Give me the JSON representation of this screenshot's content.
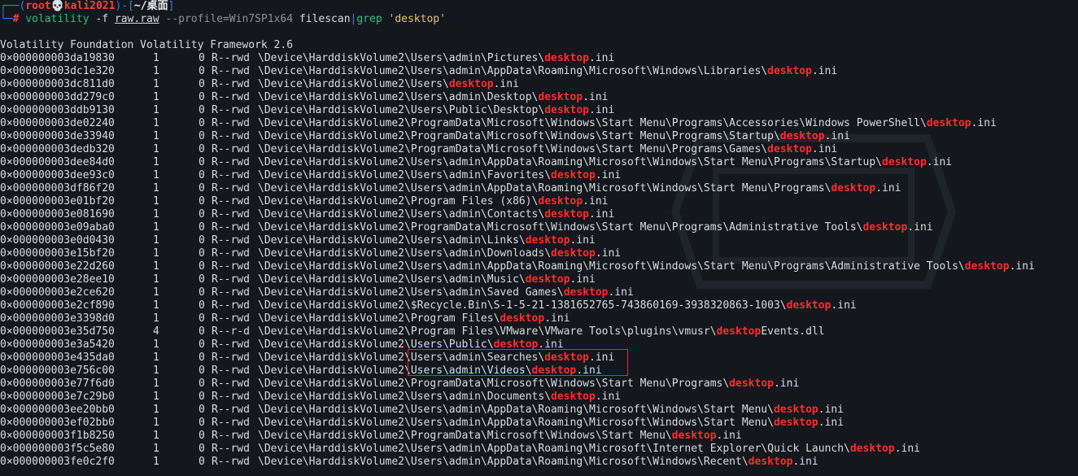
{
  "prompt": {
    "user": "root",
    "skull": "💀",
    "host": "kali2021",
    "cwd": "~/桌面",
    "hash": "#"
  },
  "command": {
    "program": "volatility",
    "flag_f": "-f",
    "image": "raw.raw",
    "profile": "--profile=Win7SP1x64",
    "plugin": "filescan",
    "pipe": "|",
    "grep": "grep",
    "pattern": "'desktop'"
  },
  "banner": "Volatility Foundation Volatility Framework 2.6",
  "search_term": "desktop",
  "rows": [
    {
      "offset": "0×000000003da19830",
      "p": "1",
      "h": "0",
      "acc": "R--rwd",
      "pre": "\\Device\\HarddiskVolume2\\Users\\admin\\Pictures\\",
      "hit": "desktop",
      "post": ".ini"
    },
    {
      "offset": "0×000000003dc1e320",
      "p": "1",
      "h": "0",
      "acc": "R--rwd",
      "pre": "\\Device\\HarddiskVolume2\\Users\\admin\\AppData\\Roaming\\Microsoft\\Windows\\Libraries\\",
      "hit": "desktop",
      "post": ".ini"
    },
    {
      "offset": "0×000000003dc811d0",
      "p": "1",
      "h": "0",
      "acc": "R--rwd",
      "pre": "\\Device\\HarddiskVolume2\\Users\\",
      "hit": "desktop",
      "post": ".ini"
    },
    {
      "offset": "0×000000003dd279c0",
      "p": "1",
      "h": "0",
      "acc": "R--rwd",
      "pre": "\\Device\\HarddiskVolume2\\Users\\admin\\Desktop\\",
      "hit": "desktop",
      "post": ".ini"
    },
    {
      "offset": "0×000000003ddb9130",
      "p": "1",
      "h": "0",
      "acc": "R--rwd",
      "pre": "\\Device\\HarddiskVolume2\\Users\\Public\\Desktop\\",
      "hit": "desktop",
      "post": ".ini"
    },
    {
      "offset": "0×000000003de02240",
      "p": "1",
      "h": "0",
      "acc": "R--rwd",
      "pre": "\\Device\\HarddiskVolume2\\ProgramData\\Microsoft\\Windows\\Start Menu\\Programs\\Accessories\\Windows PowerShell\\",
      "hit": "desktop",
      "post": ".ini"
    },
    {
      "offset": "0×000000003de33940",
      "p": "1",
      "h": "0",
      "acc": "R--rwd",
      "pre": "\\Device\\HarddiskVolume2\\ProgramData\\Microsoft\\Windows\\Start Menu\\Programs\\Startup\\",
      "hit": "desktop",
      "post": ".ini"
    },
    {
      "offset": "0×000000003dedb320",
      "p": "1",
      "h": "0",
      "acc": "R--rwd",
      "pre": "\\Device\\HarddiskVolume2\\ProgramData\\Microsoft\\Windows\\Start Menu\\Programs\\Games\\",
      "hit": "desktop",
      "post": ".ini"
    },
    {
      "offset": "0×000000003dee84d0",
      "p": "1",
      "h": "0",
      "acc": "R--rwd",
      "pre": "\\Device\\HarddiskVolume2\\Users\\admin\\AppData\\Roaming\\Microsoft\\Windows\\Start Menu\\Programs\\Startup\\",
      "hit": "desktop",
      "post": ".ini"
    },
    {
      "offset": "0×000000003dee93c0",
      "p": "1",
      "h": "0",
      "acc": "R--rwd",
      "pre": "\\Device\\HarddiskVolume2\\Users\\admin\\Favorites\\",
      "hit": "desktop",
      "post": ".ini"
    },
    {
      "offset": "0×000000003df86f20",
      "p": "1",
      "h": "0",
      "acc": "R--rwd",
      "pre": "\\Device\\HarddiskVolume2\\Users\\admin\\AppData\\Roaming\\Microsoft\\Windows\\Start Menu\\Programs\\",
      "hit": "desktop",
      "post": ".ini"
    },
    {
      "offset": "0×000000003e01bf20",
      "p": "1",
      "h": "0",
      "acc": "R--rwd",
      "pre": "\\Device\\HarddiskVolume2\\Program Files (x86)\\",
      "hit": "desktop",
      "post": ".ini"
    },
    {
      "offset": "0×000000003e081690",
      "p": "1",
      "h": "0",
      "acc": "R--rwd",
      "pre": "\\Device\\HarddiskVolume2\\Users\\admin\\Contacts\\",
      "hit": "desktop",
      "post": ".ini"
    },
    {
      "offset": "0×000000003e09aba0",
      "p": "1",
      "h": "0",
      "acc": "R--rwd",
      "pre": "\\Device\\HarddiskVolume2\\ProgramData\\Microsoft\\Windows\\Start Menu\\Programs\\Administrative Tools\\",
      "hit": "desktop",
      "post": ".ini"
    },
    {
      "offset": "0×000000003e0d0430",
      "p": "1",
      "h": "0",
      "acc": "R--rwd",
      "pre": "\\Device\\HarddiskVolume2\\Users\\admin\\Links\\",
      "hit": "desktop",
      "post": ".ini"
    },
    {
      "offset": "0×000000003e15bf20",
      "p": "1",
      "h": "0",
      "acc": "R--rwd",
      "pre": "\\Device\\HarddiskVolume2\\Users\\admin\\Downloads\\",
      "hit": "desktop",
      "post": ".ini"
    },
    {
      "offset": "0×000000003e22d260",
      "p": "1",
      "h": "0",
      "acc": "R--rwd",
      "pre": "\\Device\\HarddiskVolume2\\Users\\admin\\AppData\\Roaming\\Microsoft\\Windows\\Start Menu\\Programs\\Administrative Tools\\",
      "hit": "desktop",
      "post": ".ini"
    },
    {
      "offset": "0×000000003e28ee10",
      "p": "1",
      "h": "0",
      "acc": "R--rwd",
      "pre": "\\Device\\HarddiskVolume2\\Users\\admin\\Music\\",
      "hit": "desktop",
      "post": ".ini"
    },
    {
      "offset": "0×000000003e2ce620",
      "p": "1",
      "h": "0",
      "acc": "R--rwd",
      "pre": "\\Device\\HarddiskVolume2\\Users\\admin\\Saved Games\\",
      "hit": "desktop",
      "post": ".ini"
    },
    {
      "offset": "0×000000003e2cf890",
      "p": "1",
      "h": "0",
      "acc": "R--rwd",
      "pre": "\\Device\\HarddiskVolume2\\$Recycle.Bin\\S-1-5-21-1381652765-743860169-3938320863-1003\\",
      "hit": "desktop",
      "post": ".ini"
    },
    {
      "offset": "0×000000003e3398d0",
      "p": "1",
      "h": "0",
      "acc": "R--rwd",
      "pre": "\\Device\\HarddiskVolume2\\Program Files\\",
      "hit": "desktop",
      "post": ".ini"
    },
    {
      "offset": "0×000000003e35d750",
      "p": "4",
      "h": "0",
      "acc": "R--r-d",
      "pre": "\\Device\\HarddiskVolume2\\Program Files\\VMware\\VMware Tools\\plugins\\vmusr\\",
      "hit": "desktop",
      "post": "Events.dll"
    },
    {
      "offset": "0×000000003e3a5420",
      "p": "1",
      "h": "0",
      "acc": "R--rwd",
      "pre": "\\Device\\HarddiskVolume2\\Users\\Public\\",
      "hit": "desktop",
      "post": ".ini"
    },
    {
      "offset": "0×000000003e435da0",
      "p": "1",
      "h": "0",
      "acc": "R--rwd",
      "pre": "\\Device\\HarddiskVolume2\\Users\\admin\\Searches\\",
      "hit": "desktop",
      "post": ".ini"
    },
    {
      "offset": "0×000000003e756c00",
      "p": "1",
      "h": "0",
      "acc": "R--rwd",
      "pre": "\\Device\\HarddiskVolume2\\Users\\admin\\Videos\\",
      "hit": "desktop",
      "post": ".ini"
    },
    {
      "offset": "0×000000003e77f6d0",
      "p": "1",
      "h": "0",
      "acc": "R--rwd",
      "pre": "\\Device\\HarddiskVolume2\\ProgramData\\Microsoft\\Windows\\Start Menu\\Programs\\",
      "hit": "desktop",
      "post": ".ini"
    },
    {
      "offset": "0×000000003e7c29b0",
      "p": "1",
      "h": "0",
      "acc": "R--rwd",
      "pre": "\\Device\\HarddiskVolume2\\Users\\admin\\Documents\\",
      "hit": "desktop",
      "post": ".ini"
    },
    {
      "offset": "0×000000003ee20bb0",
      "p": "1",
      "h": "0",
      "acc": "R--rwd",
      "pre": "\\Device\\HarddiskVolume2\\Users\\admin\\AppData\\Roaming\\Microsoft\\Windows\\Start Menu\\",
      "hit": "desktop",
      "post": ".ini"
    },
    {
      "offset": "0×000000003ef02bb0",
      "p": "1",
      "h": "0",
      "acc": "R--rwd",
      "pre": "\\Device\\HarddiskVolume2\\Users\\admin\\AppData\\Roaming\\Microsoft\\Windows\\Start Menu\\",
      "hit": "desktop",
      "post": ".ini"
    },
    {
      "offset": "0×000000003f1b8250",
      "p": "1",
      "h": "0",
      "acc": "R--rwd",
      "pre": "\\Device\\HarddiskVolume2\\ProgramData\\Microsoft\\Windows\\Start Menu\\",
      "hit": "desktop",
      "post": ".ini"
    },
    {
      "offset": "0×000000003f5c5e80",
      "p": "1",
      "h": "0",
      "acc": "R--rwd",
      "pre": "\\Device\\HarddiskVolume2\\Users\\admin\\AppData\\Roaming\\Microsoft\\Internet Explorer\\Quick Launch\\",
      "hit": "desktop",
      "post": ".ini"
    },
    {
      "offset": "0×000000003fe0c2f0",
      "p": "1",
      "h": "0",
      "acc": "R--rwd",
      "pre": "\\Device\\HarddiskVolume2\\Users\\admin\\AppData\\Roaming\\Microsoft\\Windows\\Recent\\",
      "hit": "desktop",
      "post": ".ini"
    }
  ],
  "colors": {
    "background": "#14171d",
    "prompt_bracket": "#3f7bd6",
    "prompt_root": "#ff3b3b",
    "command": "#2ec27e",
    "match_highlight": "#ff2b2b",
    "annotation_box": "#e02b2b"
  }
}
